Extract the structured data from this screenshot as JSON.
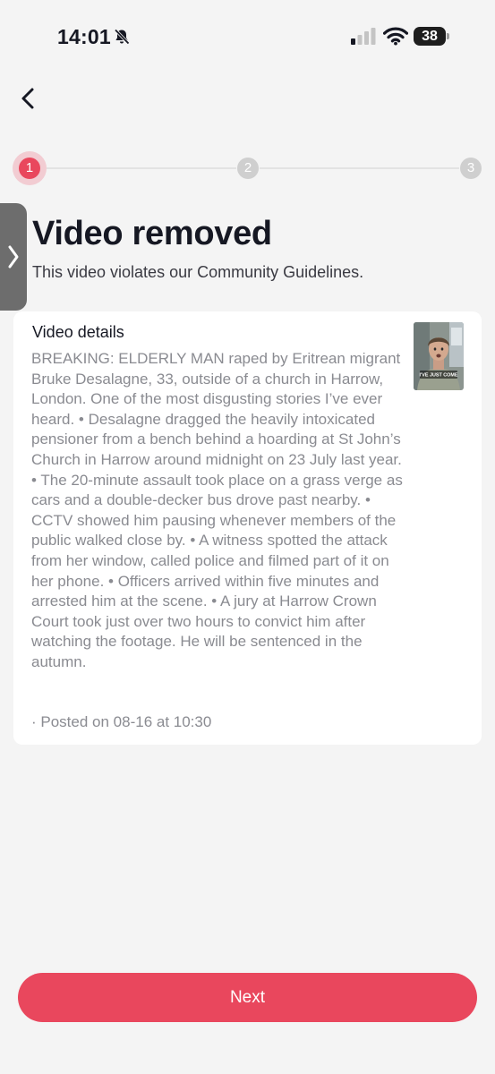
{
  "status_bar": {
    "time": "14:01",
    "battery": "38",
    "icons": [
      "bell-muted-icon",
      "cellular-signal-icon",
      "wifi-icon",
      "battery-icon"
    ]
  },
  "navigation": {
    "back_icon": "chevron-left-icon",
    "side_tab_icon": "chevron-right-icon"
  },
  "stepper": {
    "current_step": 1,
    "steps": [
      "1",
      "2",
      "3"
    ]
  },
  "header": {
    "title": "Video removed",
    "subtitle": "This video violates our Community Guidelines."
  },
  "video_details": {
    "heading": "Video details",
    "description": "BREAKING: ELDERLY MAN raped by Eritrean migrant Bruke Desalagne, 33, outside of a church in Harrow, London. One of the most disgusting stories I’ve ever heard. • Desalagne dragged the heavily intoxicated pensioner from a bench behind a hoarding at St John’s Church in Harrow around midnight on 23 July last year. • The 20-minute assault took place on a grass verge as cars and a double-decker bus drove past nearby. • CCTV showed him pausing whenever members of the public walked close by. • A witness spotted the attack from her window, called police and filmed part of it on her phone. • Officers arrived within five minutes and arrested him at the scene. • A jury at Harrow Crown Court took just over two hours to convict him after watching the footage. He will be sentenced in the autumn.",
    "posted": "· Posted on 08-16 at 10:30",
    "thumbnail_caption": "I'VE JUST COME"
  },
  "footer": {
    "next_label": "Next"
  },
  "colors": {
    "accent": "#e9475d",
    "background": "#f4f4f4",
    "card": "#ffffff",
    "muted_text": "#8a8b91",
    "step_inactive": "#cfcfcf"
  }
}
